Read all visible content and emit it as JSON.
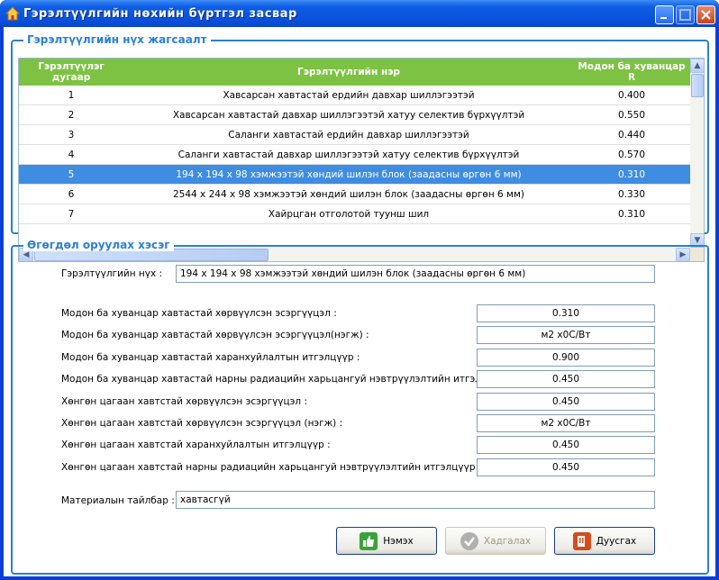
{
  "window": {
    "title": "Гэрэлтүүлгийн нөхийн бүртгэл засвар",
    "title_icon": "home-icon",
    "controls": [
      "minimize-icon",
      "maximize-icon",
      "close-icon"
    ]
  },
  "list_group": {
    "legend": "Гэрэлтүүлгийн нүх жагсаалт",
    "columns": [
      "Гэрэлтүүлэг дугаар",
      "Гэрэлтүүлгийн нэр",
      "Модон ба хуванцар R"
    ],
    "rows": [
      {
        "id": "1",
        "name": "Хавсарсан хавтастай ердийн давхар шиллэгээтэй",
        "r": "0.400"
      },
      {
        "id": "2",
        "name": "Хавсарсан хавтастай давхар шиллэгээтэй хатуу селектив бүрхүүлтэй",
        "r": "0.550"
      },
      {
        "id": "3",
        "name": "Саланги хавтастай ердийн давхар шиллэгээтэй",
        "r": "0.440"
      },
      {
        "id": "4",
        "name": "Саланги хавтастай давхар шиллэгээтэй хатуу селектив бүрхүүлтэй",
        "r": "0.570"
      },
      {
        "id": "5",
        "name": "194 x 194 x 98  хэмжээтэй хөндий шилэн блок (заадасны өргөн  6 мм)",
        "r": "0.310"
      },
      {
        "id": "6",
        "name": "2544 x 244 x 98  хэмжээтэй хөндий шилэн блок (заадасны өргөн  6 мм)",
        "r": "0.330"
      },
      {
        "id": "7",
        "name": "Хайрцган отголотой туунш шил",
        "r": "0.310"
      }
    ],
    "selected_row_index": 4
  },
  "input_group": {
    "legend": "Өгөгдөл оруулах хэсэг",
    "window_name_label": "Гэрэлтүүлгийн нүх :",
    "window_name_value": "194 x 194 x 98  хэмжээтэй хөндий шилэн блок (заадасны өргөн  6 мм)",
    "props": [
      {
        "label": "Модон ба хуванцар хавтастай хөрвүүлсэн эсэргүүцэл :",
        "value": "0.310"
      },
      {
        "label": "Модон ба хуванцар хавтастай хөрвүүлсэн эсэргүүцэл(нэгж) :",
        "value": "м2 х0С/Вт"
      },
      {
        "label": "Модон ба хуванцар хавтастай харанхуйлалтын итгэлцүүр :",
        "value": "0.900"
      },
      {
        "label": "Модон ба хуванцар хавтастай нарны радиацийн  харьцангуй нэвтрүүлэлтийн итгэлцүүр :",
        "value": "0.450"
      },
      {
        "label": "Хөнгөн цагаан хавтстай хөрвүүлсэн эсэргүүцэл :",
        "value": "0.450"
      },
      {
        "label": "Хөнгөн цагаан хавтстай хөрвүүлсэн эсэргүүцэл (нэгж) :",
        "value": "м2 х0С/Вт"
      },
      {
        "label": "Хөнгөн цагаан хавтстай харанхуйлалтын итгэлцүүр :",
        "value": "0.450"
      },
      {
        "label": "Хөнгөн цагаан хавтстай нарны радиацийн  харьцангуй нэвтрүүлэлтийн итгэлцүүр :",
        "value": "0.450"
      }
    ],
    "material_label": "Материалын тайлбар :",
    "material_value": "хавтасгүй"
  },
  "buttons": {
    "add": {
      "label": "Нэмэх",
      "icon": "add-icon",
      "color": "#3aa23a"
    },
    "save": {
      "label": "Хадгалах",
      "icon": "check-icon",
      "color": "#b0b0b0"
    },
    "close": {
      "label": "Дуусгах",
      "icon": "exit-icon",
      "color": "#d64b1c"
    }
  },
  "colors": {
    "title_bar": "#0a52dd",
    "accent": "#2b7fd6",
    "grid_header": "#7dc242",
    "selection": "#3e8de0"
  }
}
